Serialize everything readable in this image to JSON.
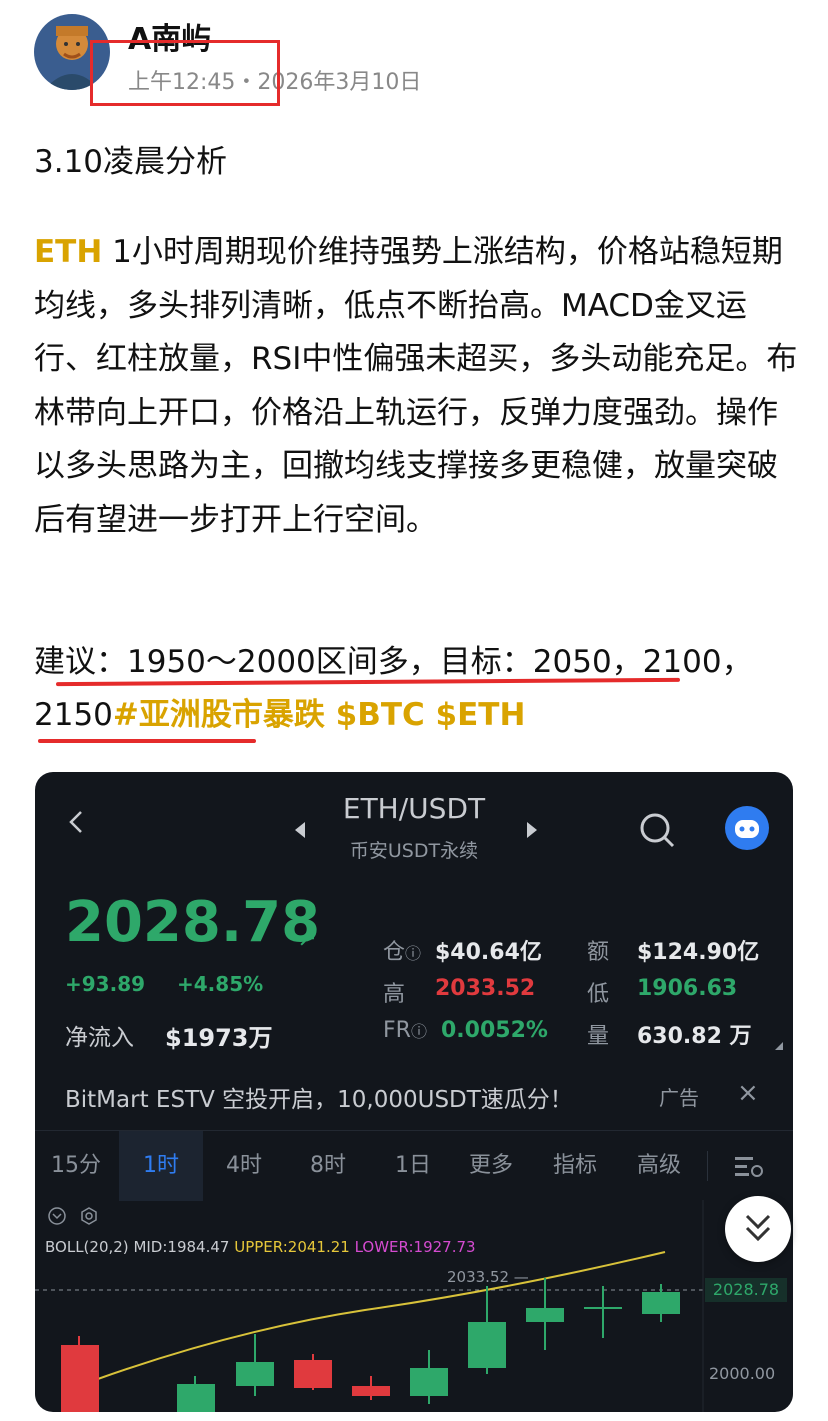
{
  "post": {
    "author": "A南屿",
    "time": "上午12:45",
    "separator": "・",
    "date": "2026年3月10日",
    "title": "3.10凌晨分析",
    "body_token": "ETH",
    "body": " 1小时周期现价维持强势上涨结构，价格站稳短期均线，多头排列清晰，低点不断抬高。MACD金叉运行、红柱放量，RSI中性偏强未超买，多头动能充足。布林带向上开口，价格沿上轨运行，反弹力度强劲。操作以多头思路为主，回撤均线支撑接多更稳健，放量突破后有望进一步打开上行空间。",
    "suggestion": "建议：1950～2000区间多，目标：2050，2100，2150",
    "hashtags": "#亚洲股市暴跌 $BTC $ETH"
  },
  "app": {
    "pair": "ETH/USDT",
    "exchange": "币安USDT永续",
    "price": "2028.78",
    "price_arrow": "↗",
    "change_abs": "+93.89",
    "change_pct": "+4.85%",
    "net_inflow_label": "净流入",
    "net_inflow_value": "$1973万",
    "stats": {
      "oi_label": "仓",
      "oi_value": "$40.64亿",
      "turnover_label": "额",
      "turnover_value": "$124.90亿",
      "high_label": "高",
      "high_value": "2033.52",
      "low_label": "低",
      "low_value": "1906.63",
      "fr_label": "FR",
      "fr_value": "0.0052%",
      "vol_label": "量",
      "vol_value": "630.82 万"
    },
    "ad": {
      "text": "BitMart ESTV 空投开启，10,000USDT速瓜分！",
      "tag": "广告",
      "close": "×"
    },
    "tabs": [
      "15分",
      "1时",
      "4时",
      "8时",
      "1日",
      "更多",
      "指标",
      "高级"
    ],
    "active_tab": "1时",
    "indicator": {
      "name": "BOLL(20,2)",
      "mid": "MID:1984.47",
      "upper": "UPPER:2041.21",
      "lower": "LOWER:1927.73"
    },
    "chart_high_label": "2033.52",
    "price_tag": "2028.78",
    "axis_label": "2000.00",
    "colors": {
      "up": "#2ea86a",
      "down": "#e03a3e",
      "accent": "#2f7cf0",
      "brand_gold": "#d9a300"
    }
  }
}
